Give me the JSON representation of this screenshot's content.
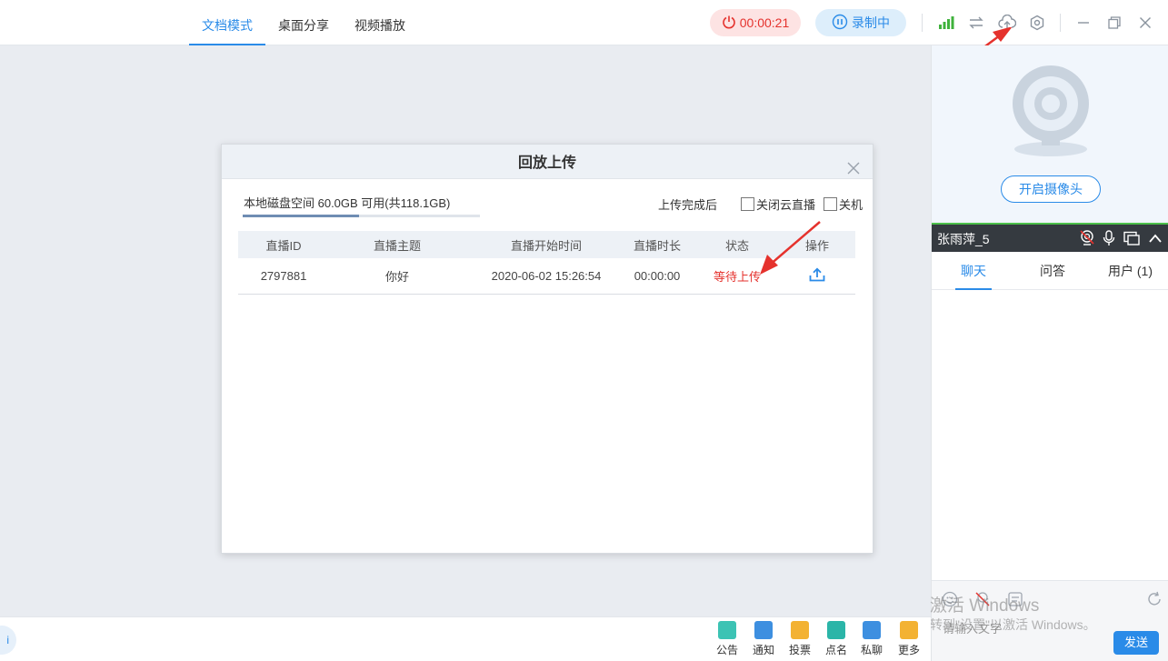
{
  "topbar": {
    "tabs": [
      {
        "label": "文档模式"
      },
      {
        "label": "桌面分享"
      },
      {
        "label": "视频播放"
      }
    ],
    "timer": "00:00:21",
    "record_label": "录制中"
  },
  "dialog": {
    "title": "回放上传",
    "disk_info": "本地磁盘空间 60.0GB 可用(共118.1GB)",
    "disk_used_fraction": 0.49,
    "after_upload_label": "上传完成后",
    "option_close_live": "关闭云直播",
    "option_shutdown": "关机",
    "columns": [
      "直播ID",
      "直播主题",
      "直播开始时间",
      "直播时长",
      "状态",
      "操作"
    ],
    "rows": [
      {
        "id": "2797881",
        "topic": "你好",
        "start": "2020-06-02 15:26:54",
        "duration": "00:00:00",
        "status": "等待上传"
      }
    ]
  },
  "right_panel": {
    "camera_button": "开启摄像头",
    "user_name": "张雨萍_5",
    "tabs": [
      {
        "label": "聊天"
      },
      {
        "label": "问答"
      },
      {
        "label": "用户 (1)"
      }
    ],
    "input_placeholder": "请输入文字",
    "send_label": "发送",
    "watermark_line1": "激活 Windows",
    "watermark_line2": "转到\"设置\"以激活 Windows。"
  },
  "bottom_toolbar": {
    "left_bubble": "i",
    "tools": [
      {
        "label": "公告",
        "color": "#3cc3b4"
      },
      {
        "label": "通知",
        "color": "#3d8fe0"
      },
      {
        "label": "投票",
        "color": "#f3b233"
      },
      {
        "label": "点名",
        "color": "#2bb5a8"
      },
      {
        "label": "私聊",
        "color": "#3d8fe0"
      },
      {
        "label": "更多",
        "color": "#f3b233"
      }
    ]
  },
  "colors": {
    "accent": "#2a8be8",
    "danger": "#e5322d",
    "signal": "#3fb23c"
  }
}
